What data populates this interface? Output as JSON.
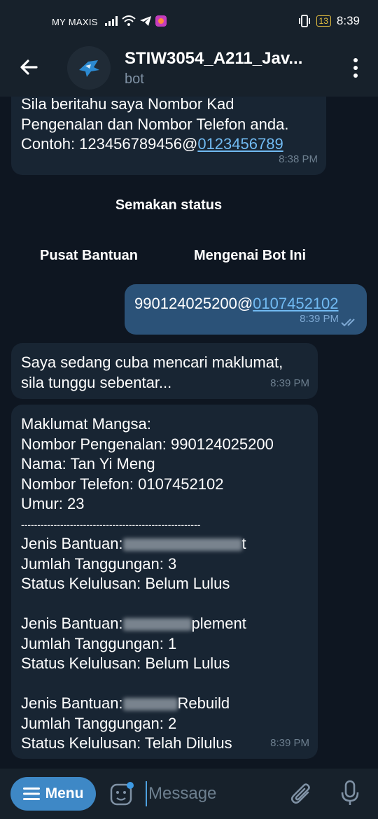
{
  "status": {
    "carrier": "MY MAXIS",
    "battery": "13",
    "time": "8:39"
  },
  "header": {
    "title": "STIW3054_A211_Jav...",
    "subtitle": "bot"
  },
  "messages": {
    "m1": {
      "line1": "Sila beritahu saya Nombor Kad",
      "line2": "Pengenalan dan Nombor Telefon anda.",
      "line3_prefix": "Contoh: 123456789456@",
      "line3_link": "0123456789",
      "time": "8:38 PM"
    },
    "m2": {
      "text_prefix": "990124025200@",
      "text_link": "0107452102",
      "time": "8:39 PM"
    },
    "m3": {
      "line1": "Saya sedang cuba mencari maklumat,",
      "line2": "sila tunggu sebentar...",
      "time": "8:39 PM"
    },
    "m4": {
      "lines": [
        "Maklumat Mangsa:",
        "Nombor Pengenalan: 990124025200",
        "Nama: Tan Yi Meng",
        "Nombor Telefon: 0107452102",
        "Umur: 23",
        "-------------------------------------------------------"
      ],
      "jenis_label": "Jenis Bantuan:",
      "blocks": [
        {
          "jenis_tail": "t",
          "tanggungan": "Jumlah Tanggungan: 3",
          "status": "Status Kelulusan: Belum Lulus"
        },
        {
          "jenis_tail": "plement",
          "tanggungan": "Jumlah Tanggungan: 1",
          "status": "Status Kelulusan: Belum Lulus"
        },
        {
          "jenis_tail": "Rebuild",
          "tanggungan": "Jumlah Tanggungan: 2",
          "status": "Status Kelulusan: Telah Dilulus"
        }
      ],
      "time": "8:39 PM"
    }
  },
  "keyboard": {
    "semakan": "Semakan status",
    "pusat": "Pusat Bantuan",
    "mengenai": "Mengenai Bot Ini"
  },
  "bottom": {
    "menu_label": "Menu",
    "placeholder": "Message"
  },
  "colors": {
    "accent": "#3e88c6",
    "bubble_in": "#182533",
    "bubble_out": "#2b5278",
    "link": "#71baf2"
  }
}
